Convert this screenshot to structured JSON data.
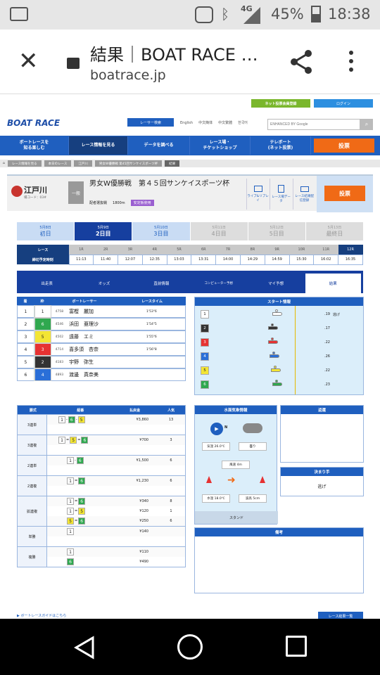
{
  "status_bar": {
    "network": "4G",
    "battery": "45%",
    "time": "18:38"
  },
  "browser": {
    "title": "結果｜BOAT RACE …",
    "url": "boatrace.jp"
  },
  "site": {
    "logo": "BOAT RACE",
    "member_reg": "ネット投票会員登録",
    "login": "ログイン",
    "racer_search": "レーサー検索",
    "langs": [
      "English",
      "中文簡体",
      "中文繁體",
      "한국어"
    ],
    "search_placeholder": "ENHANCED BY Google",
    "nav": [
      "ボートレースを\n知る楽しむ",
      "レース情報を見る",
      "データを調べる",
      "レース場・\nチケットショップ",
      "テレボート\n(ネット投票)"
    ],
    "vote": "投票"
  },
  "breadcrumb": [
    "レース情報を見る",
    "本日のレース",
    "江戸川",
    "男女W優勝戦 第45回サンケイスポーツ杯",
    "結果"
  ],
  "race_header": {
    "stadium": "江戸川",
    "stadium_code": "場コード：03#",
    "grade": "一般",
    "title": "男女W優勝戦　第４５回サンケイスポーツ杯",
    "detail": "配者選抜戦",
    "distance": "1800m",
    "stabilizer": "安定板使用",
    "links": [
      "ライブ&リプレイ",
      "レース場データ",
      "レース結果配信登録"
    ],
    "vote": "投票"
  },
  "days": [
    {
      "date": "5月8日",
      "label": "初日",
      "state": "past"
    },
    {
      "date": "5月9日",
      "label": "2日目",
      "state": "active"
    },
    {
      "date": "5月10日",
      "label": "3日目",
      "state": "past"
    },
    {
      "date": "5月11日",
      "label": "4日目",
      "state": "future"
    },
    {
      "date": "5月12日",
      "label": "5日目",
      "state": "future"
    },
    {
      "date": "5月13日",
      "label": "最終日",
      "state": "future"
    }
  ],
  "schedule": {
    "race_label": "レース",
    "time_label": "締切予定時刻",
    "races": [
      "1R",
      "2R",
      "3R",
      "4R",
      "5R",
      "6R",
      "7R",
      "8R",
      "9R",
      "10R",
      "11R",
      "12R"
    ],
    "times": [
      "11:13",
      "11:40",
      "12:07",
      "12:35",
      "13:03",
      "13:31",
      "14:00",
      "14:29",
      "14:59",
      "15:30",
      "16:02",
      "16:35"
    ]
  },
  "tabs": [
    "出走表",
    "オッズ",
    "直前情報",
    "コンピューター予想",
    "マイ予想",
    "結果"
  ],
  "result_table": {
    "headers": [
      "着",
      "枠",
      "ボートレーサー",
      "レースタイム"
    ],
    "rows": [
      {
        "place": "1",
        "frame": "1",
        "reg": "4758",
        "name": "富樫　麗加",
        "time": "1'53\"6"
      },
      {
        "place": "2",
        "frame": "6",
        "reg": "4546",
        "name": "浜田　亜理沙",
        "time": "1'54\"5"
      },
      {
        "place": "3",
        "frame": "5",
        "reg": "4502",
        "name": "遠藤　エミ",
        "time": "1'55\"6"
      },
      {
        "place": "4",
        "frame": "3",
        "reg": "4714",
        "name": "喜多須　杏奈",
        "time": "1'56\"8"
      },
      {
        "place": "5",
        "frame": "2",
        "reg": "4183",
        "name": "宇野　弥生",
        "time": ""
      },
      {
        "place": "6",
        "frame": "4",
        "reg": "4893",
        "name": "渡邊　真奈美",
        "time": ""
      }
    ]
  },
  "start_info": {
    "title": "スタート情報",
    "rows": [
      {
        "frame": "1",
        "st": ".19",
        "note": "逃げ"
      },
      {
        "frame": "2",
        "st": ".17",
        "note": ""
      },
      {
        "frame": "3",
        "st": ".22",
        "note": ""
      },
      {
        "frame": "4",
        "st": ".26",
        "note": ""
      },
      {
        "frame": "5",
        "st": ".22",
        "note": ""
      },
      {
        "frame": "6",
        "st": ".23",
        "note": ""
      }
    ]
  },
  "payout": {
    "headers": [
      "勝式",
      "組番",
      "払戻金",
      "人気"
    ],
    "groups": [
      {
        "type": "3連単",
        "rows": [
          {
            "combo": [
              "1",
              "6",
              "5"
            ],
            "sep": "-",
            "amount": "¥3,860",
            "pop": "13"
          }
        ]
      },
      {
        "type": "3連複",
        "rows": [
          {
            "combo": [
              "1",
              "5",
              "6"
            ],
            "sep": "=",
            "amount": "¥700",
            "pop": "3"
          }
        ]
      },
      {
        "type": "2連単",
        "rows": [
          {
            "combo": [
              "1",
              "6"
            ],
            "sep": "-",
            "amount": "¥1,500",
            "pop": "6"
          }
        ]
      },
      {
        "type": "2連複",
        "rows": [
          {
            "combo": [
              "1",
              "6"
            ],
            "sep": "=",
            "amount": "¥1,230",
            "pop": "6"
          }
        ]
      },
      {
        "type": "拡連複",
        "rows": [
          {
            "combo": [
              "1",
              "6"
            ],
            "sep": "=",
            "amount": "¥340",
            "pop": "8"
          },
          {
            "combo": [
              "1",
              "5"
            ],
            "sep": "=",
            "amount": "¥120",
            "pop": "1"
          },
          {
            "combo": [
              "5",
              "6"
            ],
            "sep": "=",
            "amount": "¥250",
            "pop": "6"
          }
        ]
      },
      {
        "type": "単勝",
        "rows": [
          {
            "combo": [
              "1"
            ],
            "sep": "",
            "amount": "¥140",
            "pop": ""
          }
        ]
      },
      {
        "type": "複勝",
        "rows": [
          {
            "combo": [
              "1"
            ],
            "sep": "",
            "amount": "¥110",
            "pop": ""
          },
          {
            "combo": [
              "6"
            ],
            "sep": "",
            "amount": "¥490",
            "pop": ""
          }
        ]
      }
    ]
  },
  "weather": {
    "title": "水面気象情報",
    "temp": "気温 26.0℃",
    "condition": "曇り",
    "wind": "風速 4m",
    "water_temp": "水温 18.0℃",
    "wave": "波高 5cm",
    "stand": "スタンド",
    "north": "N"
  },
  "refund": {
    "title": "返還"
  },
  "kimarite": {
    "title": "決まり手",
    "value": "逃げ"
  },
  "remarks": {
    "title": "備考"
  },
  "footer": {
    "guide": "ボートレースガイドはこちら",
    "list": "レース結果一覧"
  },
  "colors": {
    "frame1": "#ffffff",
    "frame2": "#333333",
    "frame3": "#e63232",
    "frame4": "#2a6fd8",
    "frame5": "#f3e534",
    "frame6": "#2fa84f",
    "site_blue": "#1f5fbf",
    "orange": "#f06a16"
  }
}
